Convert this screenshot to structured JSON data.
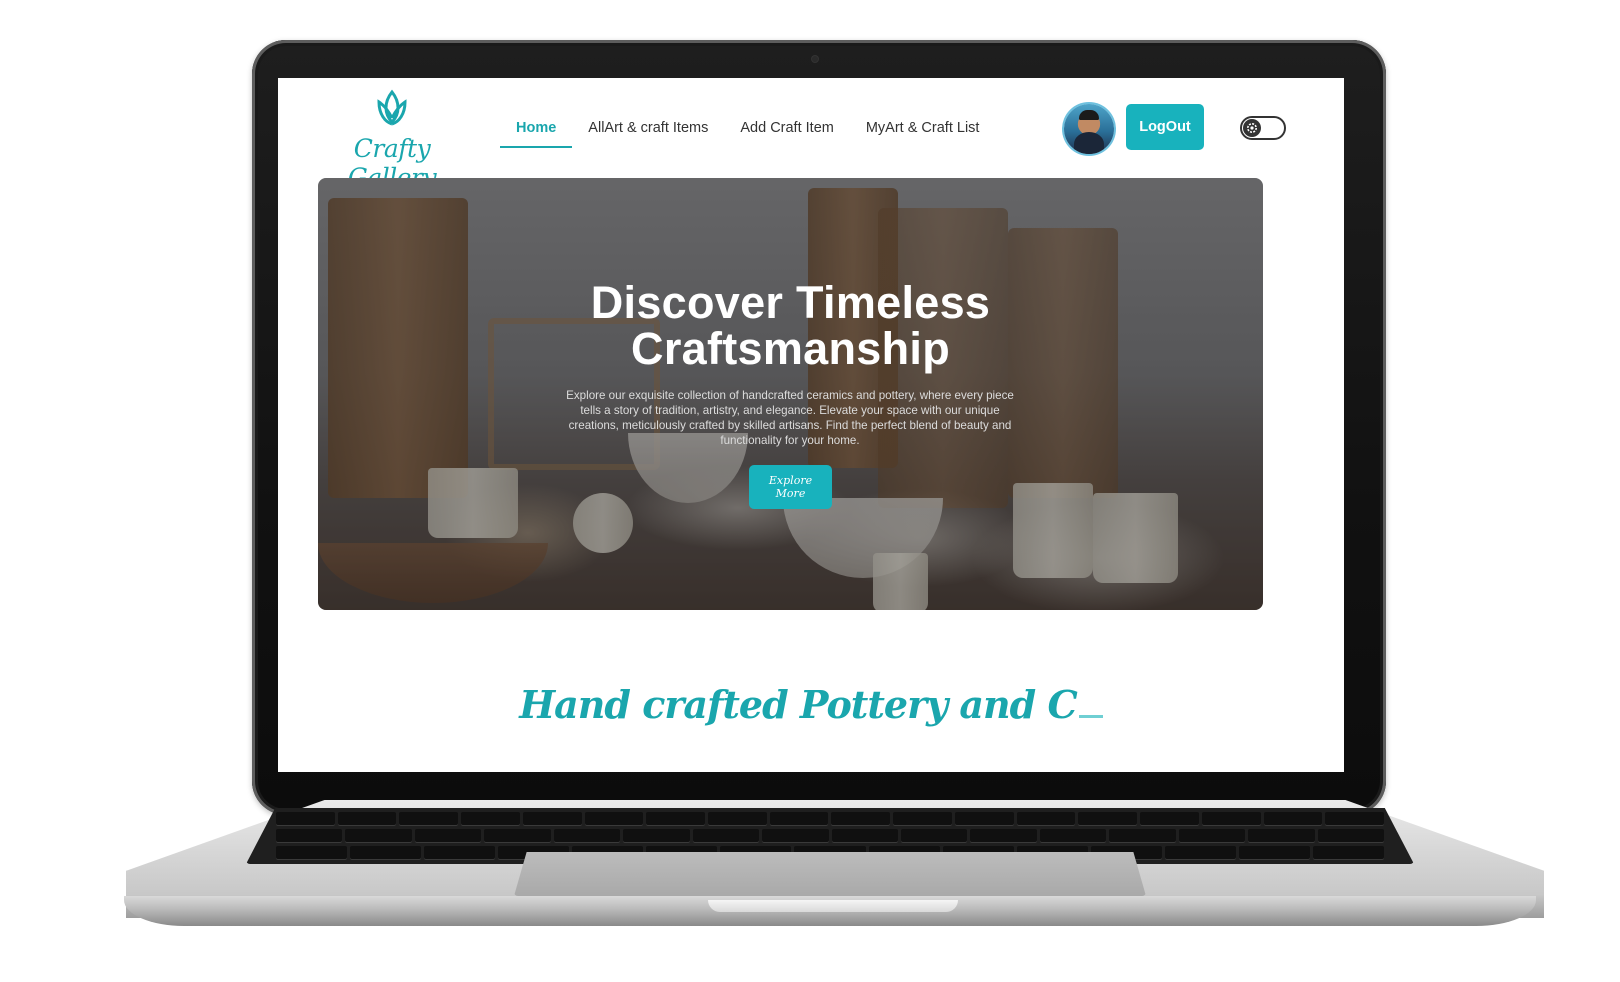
{
  "site": {
    "logo_text": "Crafty Gallery",
    "accent_color": "#18b2bd"
  },
  "nav": {
    "items": [
      {
        "label": "Home",
        "active": true
      },
      {
        "label": "AllArt & craft Items",
        "active": false
      },
      {
        "label": "Add Craft Item",
        "active": false
      },
      {
        "label": "MyArt & Craft List",
        "active": false
      }
    ],
    "logout_label": "LogOut",
    "avatar_icon": "user-avatar",
    "theme_toggle_icon": "gear-icon"
  },
  "hero": {
    "title_line1": "Discover Timeless",
    "title_line2": "Craftsmanship",
    "description": "Explore our exquisite collection of handcrafted ceramics and pottery, where every piece tells a story of tradition, artistry, and elegance. Elevate your space with our unique creations, meticulously crafted by skilled artisans. Find the perfect blend of beauty and functionality for your home.",
    "button_label": "Explore More"
  },
  "section": {
    "title": "Hand crafted Pottery and C"
  }
}
